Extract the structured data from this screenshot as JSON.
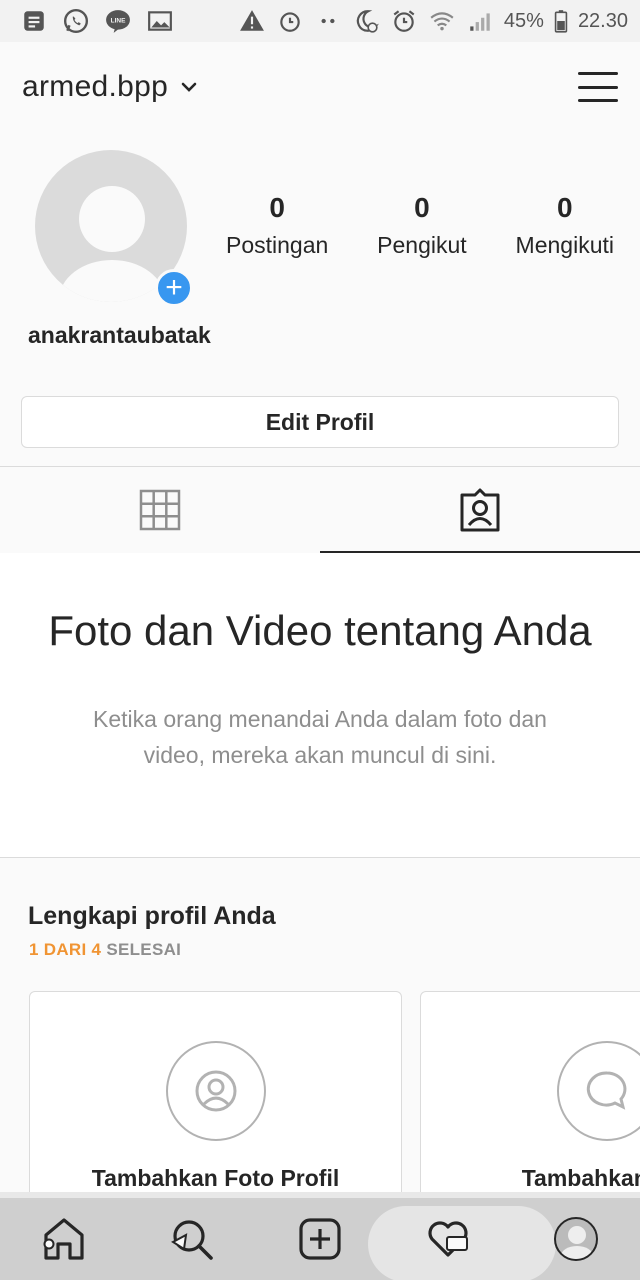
{
  "status_bar": {
    "battery": "45%",
    "time": "22.30",
    "left_icons": [
      "notes-icon",
      "whatsapp-icon",
      "line-icon",
      "gallery-icon"
    ],
    "right_icons": [
      "warning-icon",
      "alarm-icon",
      "dots-icon",
      "night-mode-icon",
      "alarm-clock-icon",
      "wifi-icon",
      "signal-icon",
      "battery-icon"
    ]
  },
  "header": {
    "username": "armed.bpp"
  },
  "profile": {
    "display_name": "anakrantaubatak",
    "stats": [
      {
        "value": "0",
        "label": "Postingan"
      },
      {
        "value": "0",
        "label": "Pengikut"
      },
      {
        "value": "0",
        "label": "Mengikuti"
      }
    ],
    "add_badge": "+",
    "edit_button": "Edit Profil"
  },
  "tabs": [
    {
      "icon": "grid-icon",
      "active": false
    },
    {
      "icon": "tagged-icon",
      "active": true
    }
  ],
  "empty_state": {
    "title": "Foto dan Video tentang Anda",
    "description": "Ketika orang menandai Anda dalam foto dan video, mereka akan muncul di sini."
  },
  "complete_profile": {
    "title": "Lengkapi profil Anda",
    "progress_done": "1 DARI 4",
    "progress_label": "SELESAI",
    "cards": [
      {
        "title": "Tambahkan Foto Profil",
        "icon": "person-icon"
      },
      {
        "title": "Tambahkan Bio",
        "icon": "speech-bubble-icon"
      }
    ]
  },
  "bottom_nav": {
    "items": [
      "home-icon",
      "search-icon",
      "add-post-icon",
      "activity-heart-icon",
      "profile-avatar-icon"
    ]
  },
  "colors": {
    "accent_blue": "#3897f0",
    "progress_orange": "#f09433",
    "text_primary": "#262626",
    "text_secondary": "#8e8e8e",
    "border": "#dbdbdb"
  }
}
